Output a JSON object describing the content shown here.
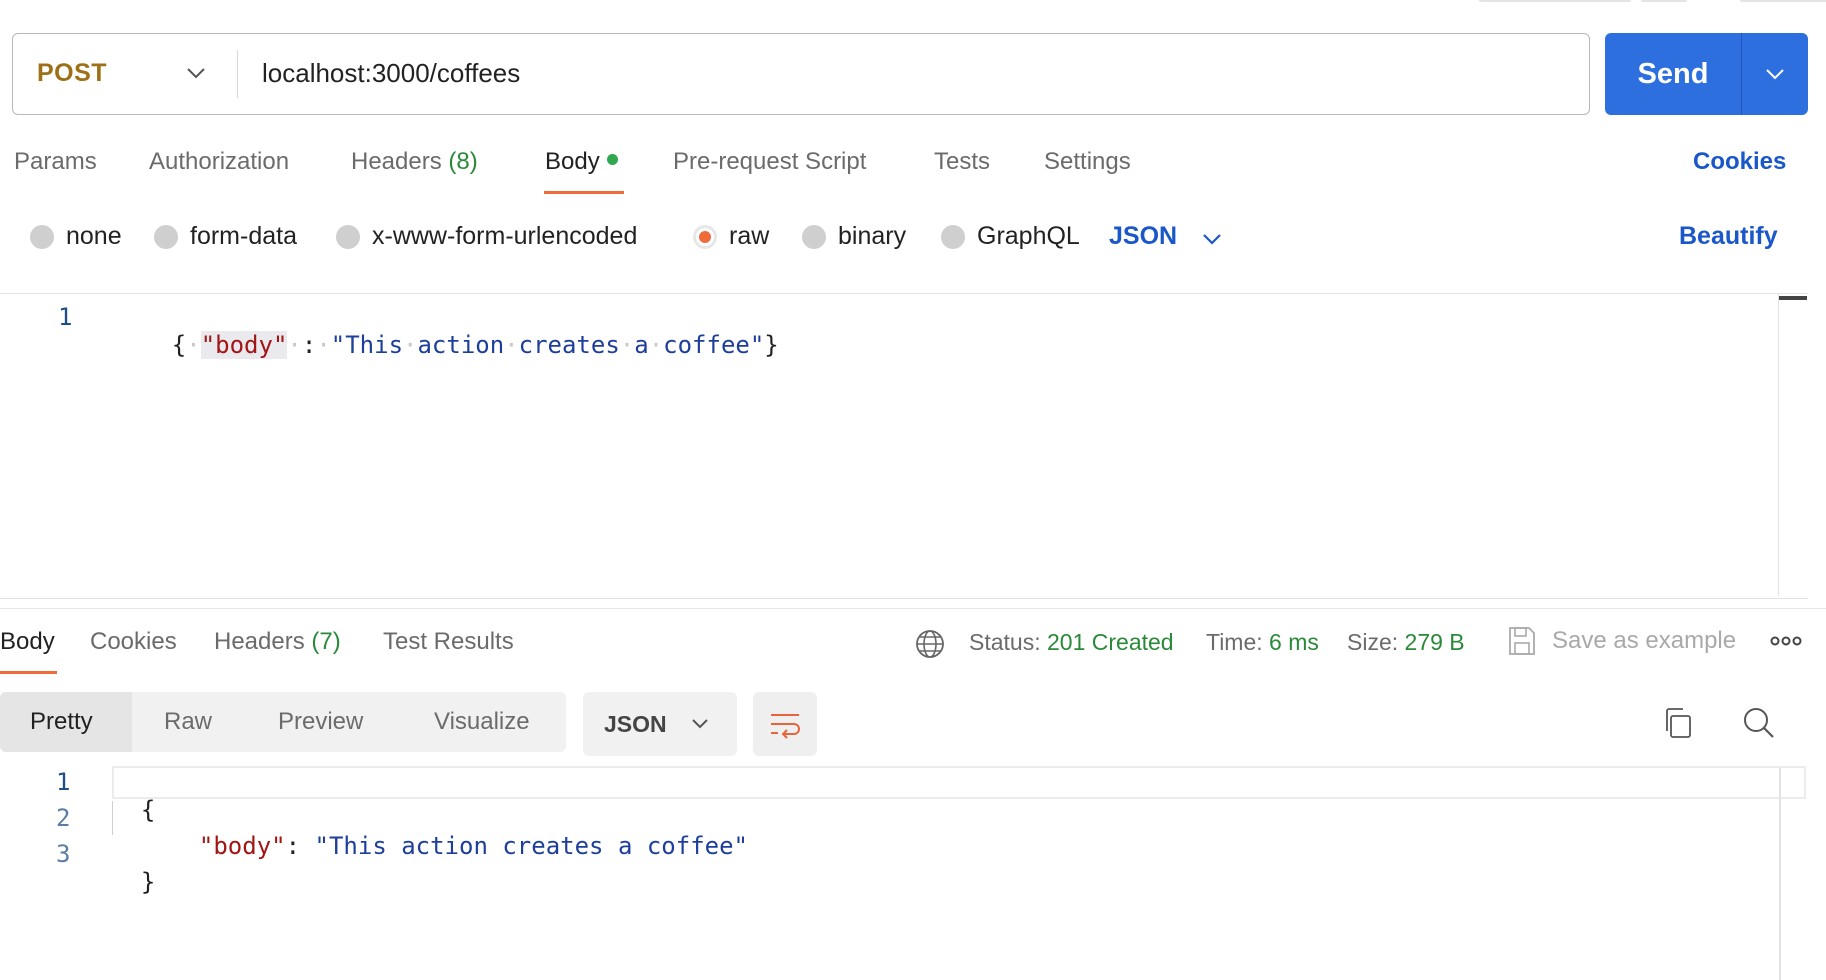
{
  "request": {
    "method": "POST",
    "url": "localhost:3000/coffees",
    "send_label": "Send"
  },
  "request_tabs": {
    "params": "Params",
    "authorization": "Authorization",
    "headers": "Headers",
    "headers_count": "(8)",
    "body": "Body",
    "pre_request": "Pre-request Script",
    "tests": "Tests",
    "settings": "Settings",
    "cookies": "Cookies"
  },
  "body_types": {
    "none": "none",
    "form_data": "form-data",
    "urlencoded": "x-www-form-urlencoded",
    "raw": "raw",
    "binary": "binary",
    "graphql": "GraphQL",
    "language": "JSON",
    "beautify": "Beautify",
    "selected": "raw"
  },
  "request_editor": {
    "line_numbers": [
      "1"
    ],
    "open_brace": "{",
    "key": "\"body\"",
    "colon": ":",
    "value_words": [
      "\"This",
      "action",
      "creates",
      "a",
      "coffee\""
    ],
    "close_brace": "}"
  },
  "response_tabs": {
    "body": "Body",
    "cookies": "Cookies",
    "headers": "Headers",
    "headers_count": "(7)",
    "test_results": "Test Results"
  },
  "response_meta": {
    "status_label": "Status:",
    "status_value": "201 Created",
    "time_label": "Time:",
    "time_value": "6 ms",
    "size_label": "Size:",
    "size_value": "279 B",
    "save_as_example": "Save as example"
  },
  "response_view": {
    "modes": [
      "Pretty",
      "Raw",
      "Preview",
      "Visualize"
    ],
    "active_mode": "Pretty",
    "format": "JSON"
  },
  "response_editor": {
    "line_numbers": [
      "1",
      "2",
      "3"
    ],
    "line1": "{",
    "key": "\"body\"",
    "colon": ":",
    "value": "\"This action creates a coffee\"",
    "line3": "}"
  },
  "colors": {
    "method": "#9d7016",
    "accent_blue": "#2e6fe0",
    "active_underline": "#ef6b3a",
    "status_green": "#2a8a3a"
  }
}
